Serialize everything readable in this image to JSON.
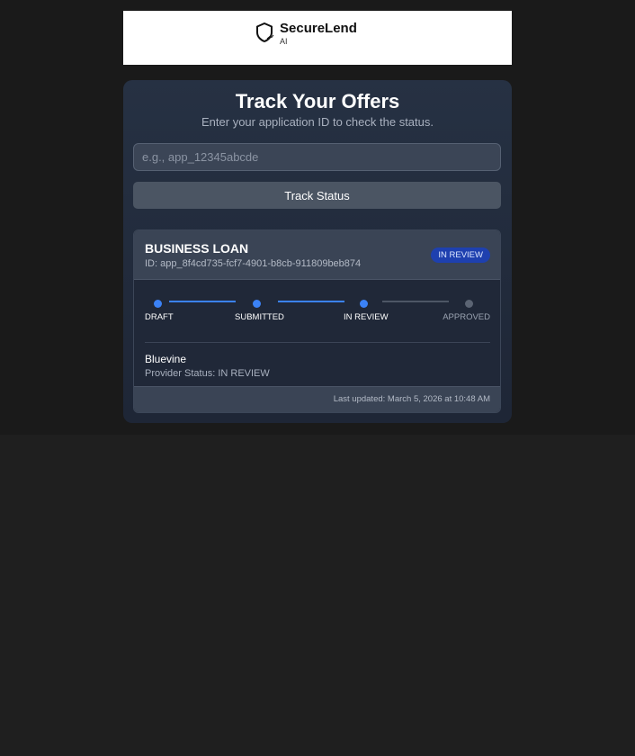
{
  "brand": {
    "name": "SecureLend",
    "sub": "AI",
    "icon": "shield-icon"
  },
  "tracker": {
    "title": "Track Your Offers",
    "subtitle": "Enter your application ID to check the status.",
    "input_value": "",
    "input_placeholder": "e.g., app_12345abcde",
    "button_label": "Track Status"
  },
  "result": {
    "loan_type": "BUSINESS LOAN",
    "app_id": "ID: app_8f4cd735-fcf7-4901-b8cb-911809beb874",
    "status_badge": "IN REVIEW",
    "steps": [
      {
        "label": "DRAFT",
        "done": true
      },
      {
        "label": "SUBMITTED",
        "done": true
      },
      {
        "label": "IN REVIEW",
        "done": true
      },
      {
        "label": "APPROVED",
        "done": false
      }
    ],
    "provider_name": "Bluevine",
    "provider_status": "Provider Status: IN REVIEW",
    "last_updated": "Last updated: March 5, 2026 at 10:48 AM"
  },
  "colors": {
    "accent": "#3b82f6",
    "badge_bg": "#1e40af",
    "card_bg": "#263143",
    "page_bg": "#1f1f1f"
  }
}
